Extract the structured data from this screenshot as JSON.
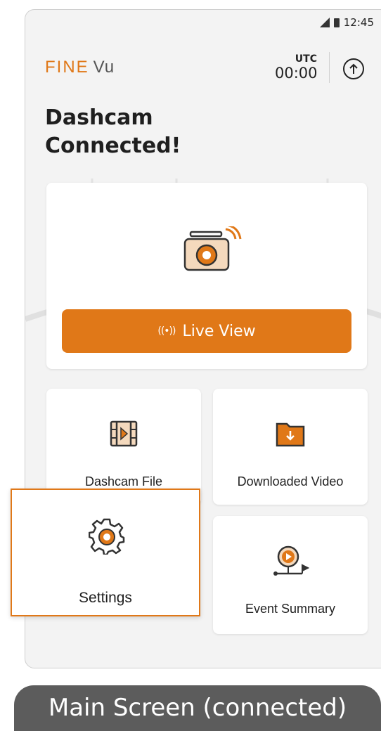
{
  "status_bar": {
    "time": "12:45"
  },
  "brand": {
    "part1": "FINE",
    "part2": "Vu",
    "accent_color": "#e07818"
  },
  "clock": {
    "label": "UTC",
    "time": "00:00"
  },
  "headline": {
    "line1": "Dashcam",
    "line2": "Connected!"
  },
  "live_view": {
    "button_label": "Live View",
    "waves_glyph": "((•))"
  },
  "tiles": {
    "dashcam_file": {
      "label": "Dashcam File",
      "icon": "film-play-icon"
    },
    "downloaded_video": {
      "label": "Downloaded Video",
      "icon": "folder-download-icon"
    },
    "settings": {
      "label": "Settings",
      "icon": "gear-icon"
    },
    "event_summary": {
      "label": "Event Summary",
      "icon": "route-play-icon"
    }
  },
  "caption": "Main Screen (connected)"
}
